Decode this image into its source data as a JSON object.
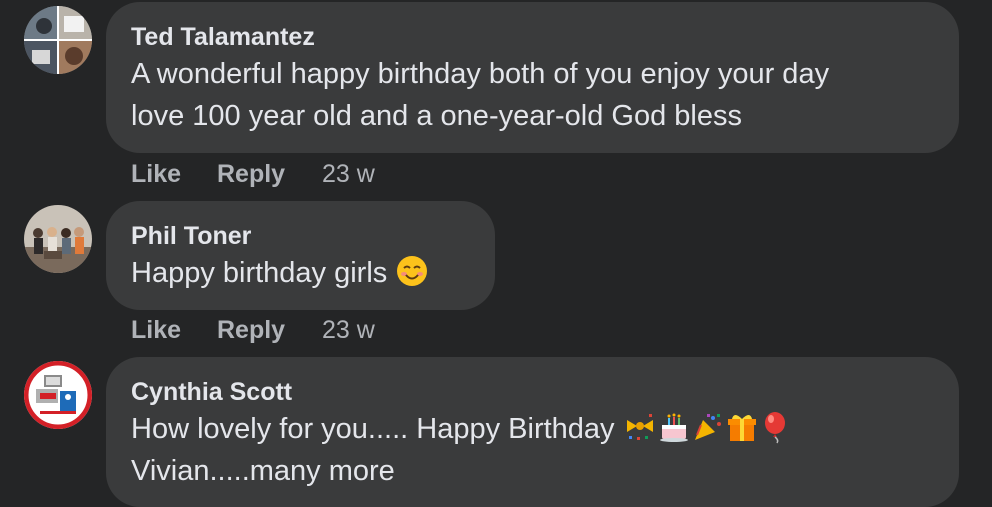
{
  "comments": [
    {
      "author": "Ted Talamantez",
      "text_line1": "A wonderful happy birthday both of you enjoy your day",
      "text_line2": "love 100 year old and a one-year-old God bless",
      "like_label": "Like",
      "reply_label": "Reply",
      "time": "23 w",
      "avatar_icon": "profile-photo-collage"
    },
    {
      "author": "Phil Toner",
      "text": "Happy birthday girls",
      "emojis": [
        "smiling-face-icon"
      ],
      "like_label": "Like",
      "reply_label": "Reply",
      "time": "23 w",
      "avatar_icon": "profile-photo-group"
    },
    {
      "author": "Cynthia Scott",
      "text_line1": "How lovely for you..... Happy Birthday",
      "text_line2": "Vivian.....many more",
      "emojis": [
        "ribbon-confetti-icon",
        "birthday-cake-icon",
        "party-popper-icon",
        "gift-icon",
        "balloon-icon"
      ],
      "avatar_icon": "profile-badge-frame"
    }
  ],
  "colors": {
    "background": "#242526",
    "bubble": "#3a3b3c",
    "primary_text": "#e4e6eb",
    "secondary_text": "#b0b3b8"
  }
}
